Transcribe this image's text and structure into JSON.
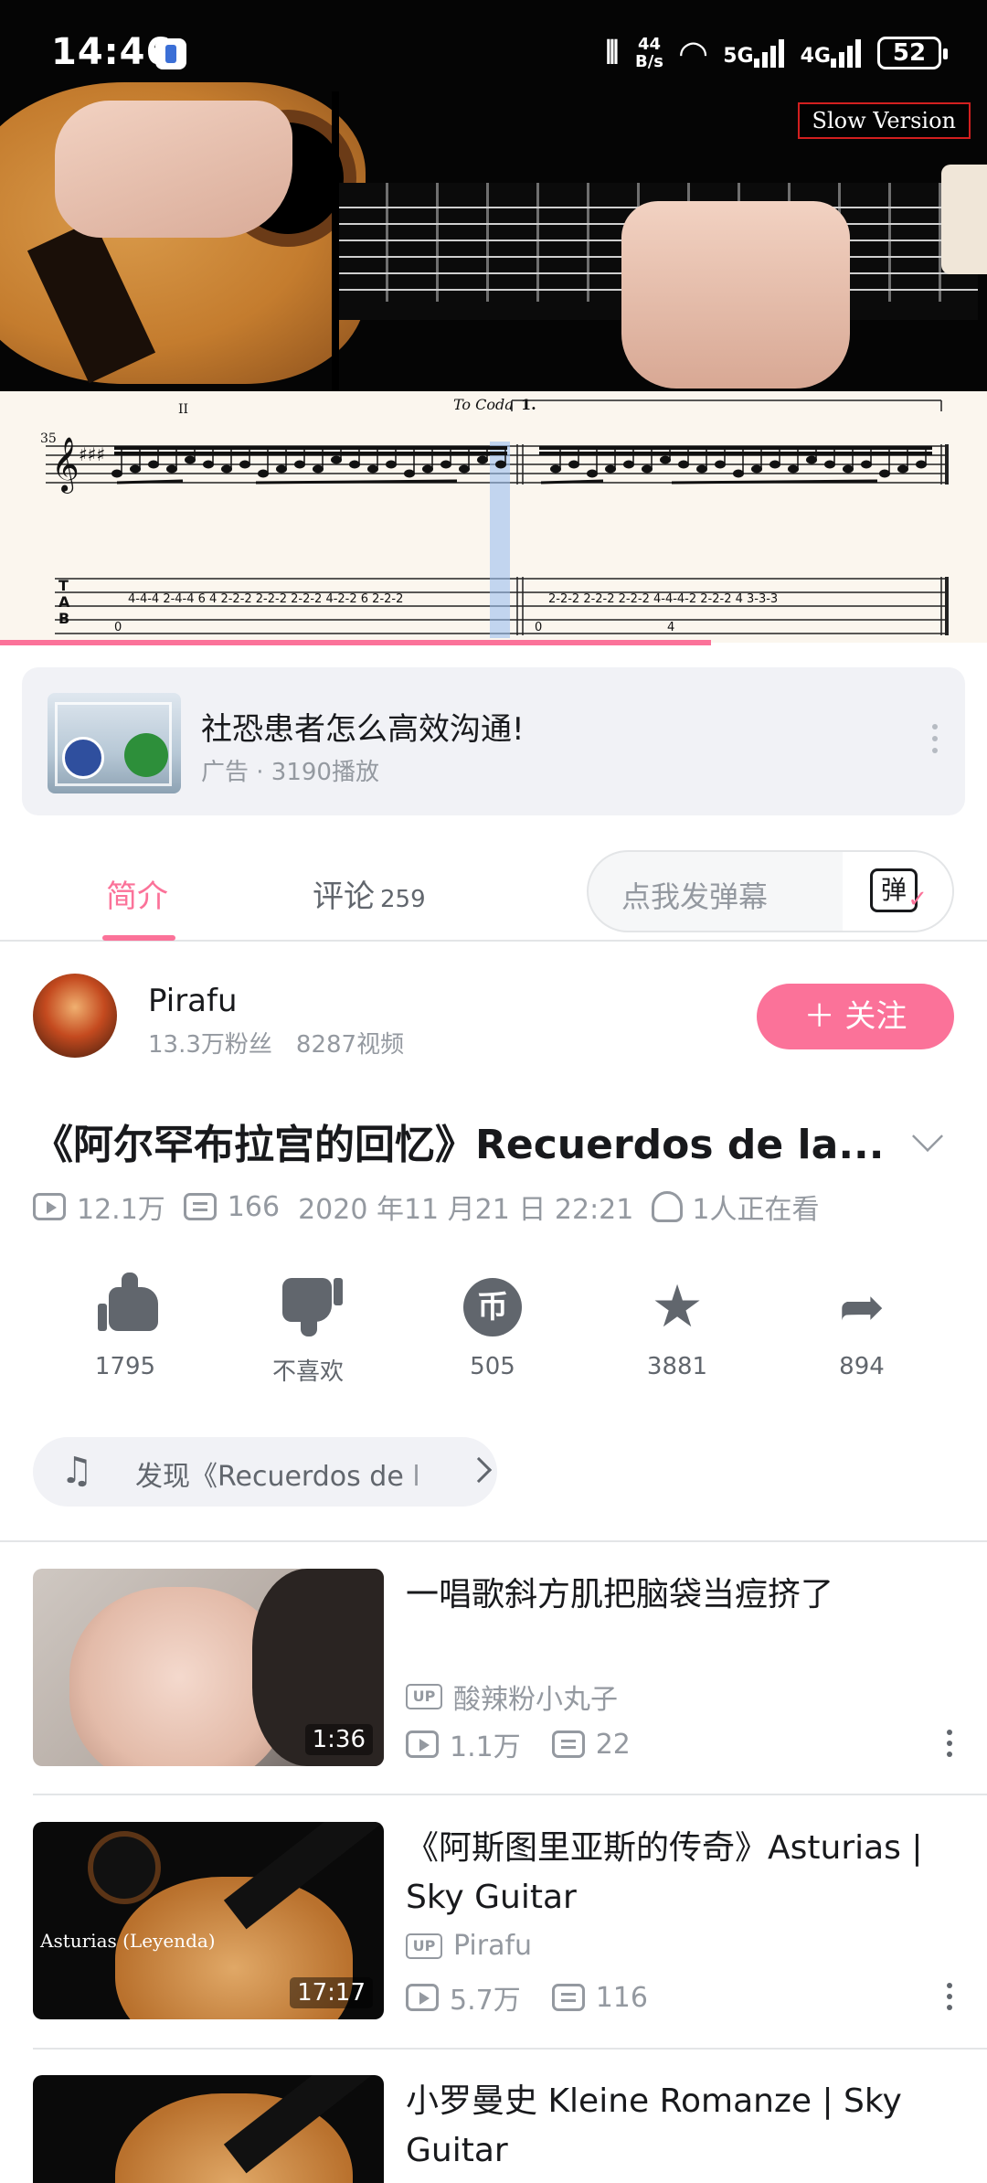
{
  "status_bar": {
    "time": "14:46",
    "net_speed_value": "44",
    "net_speed_unit": "B/s",
    "sig1": "5G",
    "sig2": "4G",
    "battery": "52",
    "icons": [
      "app-notification-icon",
      "vibrate-icon",
      "wifi-icon",
      "signal-5g-icon",
      "signal-4g-icon",
      "battery-icon"
    ]
  },
  "video": {
    "overlay_label": "Slow Version",
    "sheet": {
      "measure_number": "35",
      "coda_label": "To Coda",
      "ending_label": "1.",
      "position_mark": "II",
      "tab_letters": [
        "T",
        "A",
        "B"
      ],
      "tab_line1": "4-4-4  2-4-4 6 4  2-2-2  2-2-2  2-2-2  4-2-2  6  2-2-2",
      "tab_line2": "2-2-2  2-2-2  2-2-2  4-4-4-2  2-2-2  4  3-3-3",
      "tab_low1": "0",
      "tab_low2": "0",
      "tab_low3": "4"
    },
    "progress": 0.72
  },
  "ad": {
    "title": "社恐患者怎么高效沟通!",
    "meta": "广告 · 3190播放"
  },
  "tabs": {
    "intro": "简介",
    "comments": "评论",
    "comments_count": "259",
    "danmaku_placeholder": "点我发弹幕",
    "danmaku_button": "弹"
  },
  "uploader": {
    "name": "Pirafu",
    "fans": "13.3万粉丝",
    "videos": "8287视频",
    "follow_label": "＋ 关注"
  },
  "video_info": {
    "title": "《阿尔罕布拉宫的回忆》Recuerdos de la...",
    "views": "12.1万",
    "danmaku": "166",
    "date": "2020 年11 月21 日 22:21",
    "watching": "1人正在看"
  },
  "actions": [
    {
      "name": "like",
      "label": "1795"
    },
    {
      "name": "dislike",
      "label": "不喜欢"
    },
    {
      "name": "coin",
      "label": "505"
    },
    {
      "name": "favorite",
      "label": "3881"
    },
    {
      "name": "share",
      "label": "894"
    }
  ],
  "music": {
    "label": "发现《Recuerdos de l"
  },
  "related": [
    {
      "title": "一唱歌斜方肌把脑袋当痘挤了",
      "duration": "1:36",
      "up_badge": "UP",
      "up": "酸辣粉小丸子",
      "views": "1.1万",
      "danmaku": "22"
    },
    {
      "title": "《阿斯图里亚斯的传奇》Asturias | Sky Guitar",
      "duration": "17:17",
      "thumb_text": "Asturias (Leyenda)",
      "up_badge": "UP",
      "up": "Pirafu",
      "views": "5.7万",
      "danmaku": "116"
    },
    {
      "title": "小罗曼史 Kleine Romanze | Sky Guitar"
    }
  ],
  "colors": {
    "accent": "#fb7299",
    "text_primary": "#18191c",
    "text_secondary": "#9499a0",
    "background": "#ffffff"
  }
}
